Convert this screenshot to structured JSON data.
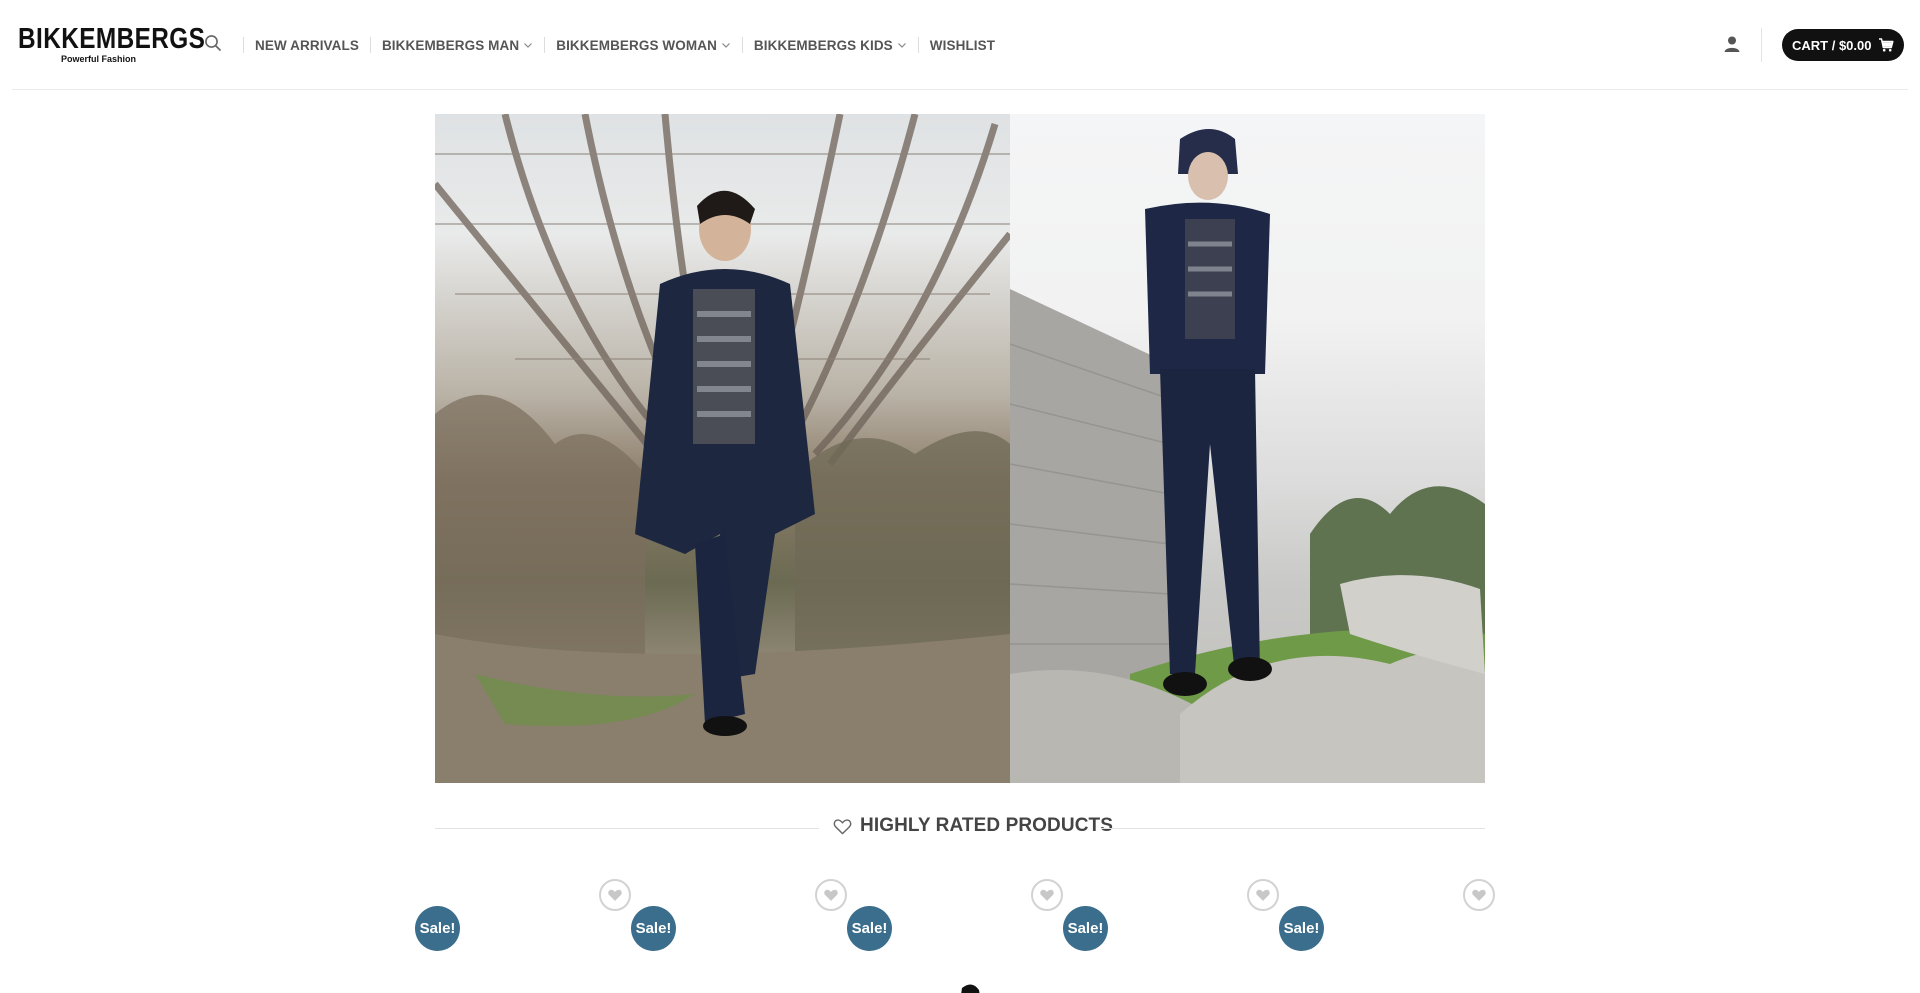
{
  "brand": {
    "name": "BIKKEMBERGS",
    "tagline": "Powerful Fashion"
  },
  "nav": {
    "items": [
      {
        "label": "NEW ARRIVALS",
        "has_dropdown": false
      },
      {
        "label": "BIKKEMBERGS MAN",
        "has_dropdown": true
      },
      {
        "label": "BIKKEMBERGS WOMAN",
        "has_dropdown": true
      },
      {
        "label": "BIKKEMBERGS KIDS",
        "has_dropdown": true
      },
      {
        "label": "WISHLIST",
        "has_dropdown": false
      }
    ]
  },
  "header": {
    "cart_label": "CART / $0.00"
  },
  "section": {
    "title": "HIGHLY RATED PRODUCTS"
  },
  "products": [
    {
      "badge": "Sale!"
    },
    {
      "badge": "Sale!"
    },
    {
      "badge": "Sale!"
    },
    {
      "badge": "Sale!"
    },
    {
      "badge": "Sale!"
    }
  ],
  "colors": {
    "cart_bg": "#111111",
    "sale_badge": "#3a6e8c",
    "nav_text": "#555555"
  },
  "icons": {
    "search": "search-icon",
    "account": "user-icon",
    "cart": "cart-icon",
    "wishlist": "heart-icon",
    "dropdown": "chevron-down-icon"
  }
}
